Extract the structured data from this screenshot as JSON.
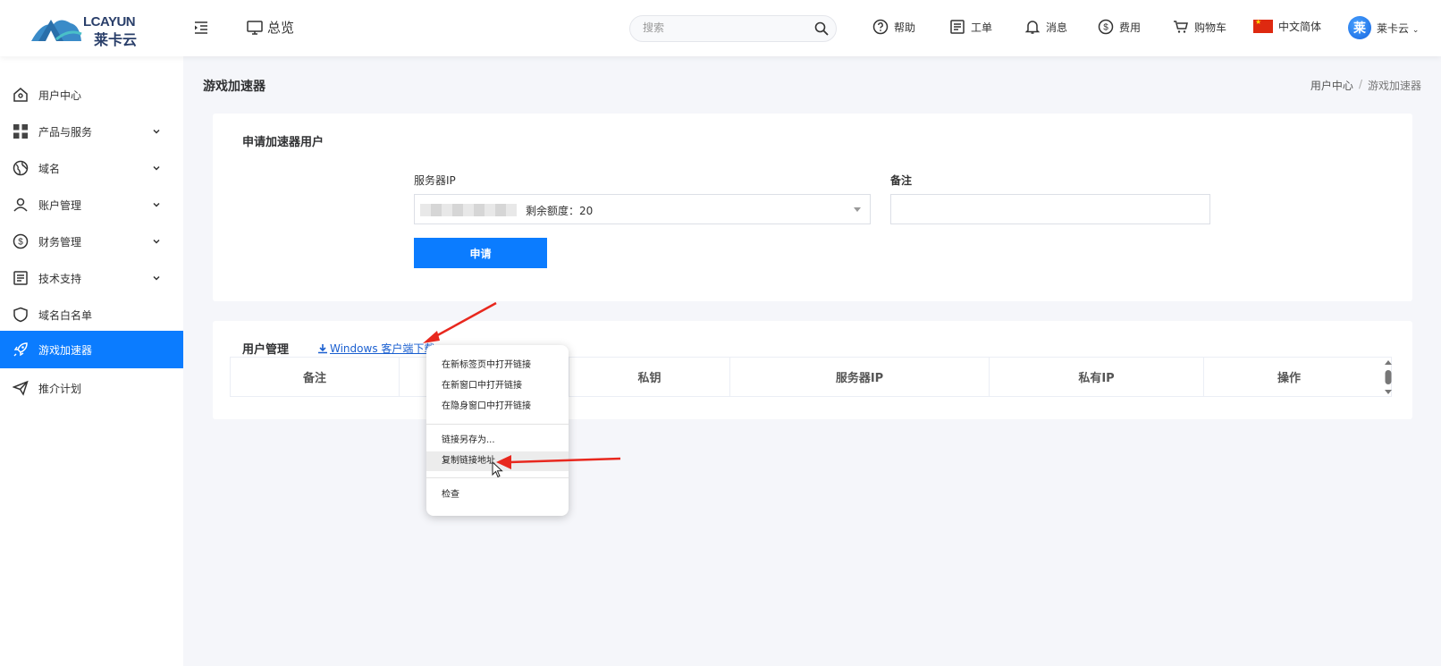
{
  "header": {
    "logo_en": "LCAYUN",
    "logo_cn": "莱卡云",
    "overview_label": "总览",
    "search_placeholder": "搜索",
    "nav": {
      "help": "帮助",
      "ticket": "工单",
      "message": "消息",
      "fee": "费用",
      "cart": "购物车",
      "language": "中文简体"
    },
    "avatar_initial": "莱",
    "username": "莱卡云"
  },
  "sidebar": {
    "items": [
      {
        "label": "用户中心",
        "icon": "home-icon",
        "has_submenu": false
      },
      {
        "label": "产品与服务",
        "icon": "grid-icon",
        "has_submenu": true
      },
      {
        "label": "域名",
        "icon": "globe-icon",
        "has_submenu": true
      },
      {
        "label": "账户管理",
        "icon": "user-icon",
        "has_submenu": true
      },
      {
        "label": "财务管理",
        "icon": "dollar-icon",
        "has_submenu": true
      },
      {
        "label": "技术支持",
        "icon": "document-icon",
        "has_submenu": true
      },
      {
        "label": "域名白名单",
        "icon": "shield-icon",
        "has_submenu": false
      },
      {
        "label": "游戏加速器",
        "icon": "rocket-icon",
        "has_submenu": false,
        "active": true
      },
      {
        "label": "推介计划",
        "icon": "paper-plane-icon",
        "has_submenu": false
      }
    ]
  },
  "page": {
    "title": "游戏加速器",
    "breadcrumb": [
      "用户中心",
      "游戏加速器"
    ]
  },
  "apply_card": {
    "title": "申请加速器用户",
    "server_ip_label": "服务器IP",
    "quota_text": "剩余额度：20",
    "remark_label": "备注",
    "remark_value": "",
    "apply_button": "申请"
  },
  "user_card": {
    "title": "用户管理",
    "download_link": "Windows 客户端下载",
    "columns": [
      "备注",
      "",
      "私钥",
      "服务器IP",
      "私有IP",
      "操作"
    ]
  },
  "context_menu": {
    "items": [
      "在新标签页中打开链接",
      "在新窗口中打开链接",
      "在隐身窗口中打开链接",
      "链接另存为...",
      "复制链接地址",
      "检查"
    ],
    "hovered": "复制链接地址"
  },
  "colors": {
    "primary": "#0b7cff",
    "annotation_arrow": "#e8281e"
  }
}
